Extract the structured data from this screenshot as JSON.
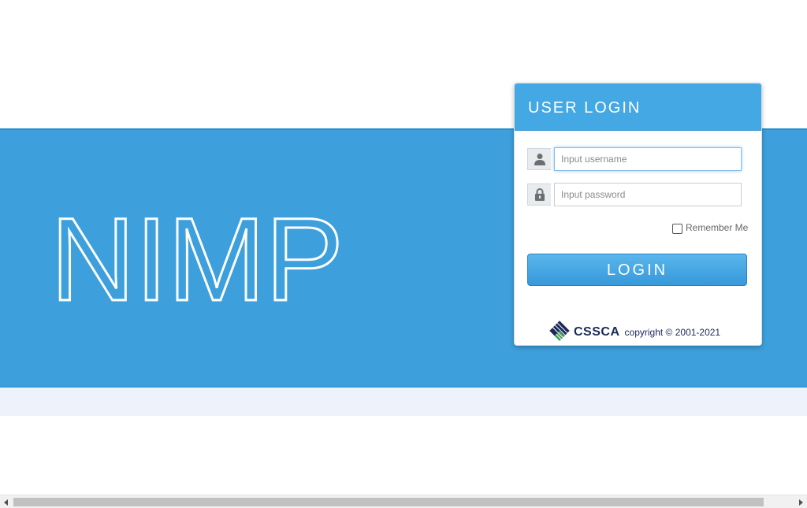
{
  "brand": {
    "name": "NIMP"
  },
  "login": {
    "title": "USER LOGIN",
    "username_placeholder": "Input username",
    "password_placeholder": "Input password",
    "remember_label": "Remember Me",
    "button_label": "LOGIN"
  },
  "footer": {
    "logo_text": "CSSCA",
    "copyright": "copyright © 2001-2021"
  },
  "icons": {
    "user": "user-icon",
    "lock": "lock-icon"
  },
  "colors": {
    "banner": "#3d9fdb",
    "header": "#43a8e3",
    "button": "#3799da",
    "logo_text": "#1b2a5a"
  }
}
